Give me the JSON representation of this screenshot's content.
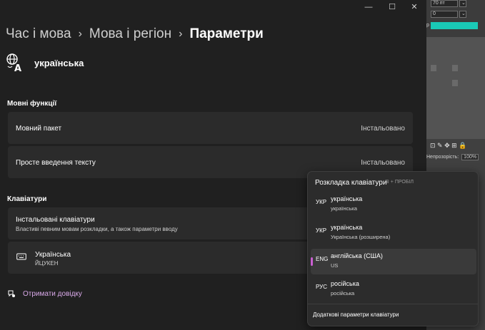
{
  "breadcrumb": {
    "item1": "Час і мова",
    "item2": "Мова і регіон",
    "current": "Параметри"
  },
  "language": {
    "title": "українська",
    "icon": "language-icon"
  },
  "lang_features": {
    "title": "Мовні функції",
    "items": [
      {
        "label": "Мовний пакет",
        "status": "Інстальовано"
      },
      {
        "label": "Просте введення тексту",
        "status": "Інстальовано"
      }
    ]
  },
  "keyboards": {
    "title": "Клавіатури",
    "installed": {
      "label": "Інстальовані клавіатури",
      "sub": "Властиві певним мовам розкладки, а також параметри вводу"
    },
    "keyboard": {
      "name": "Українська",
      "layout": "ЙЦУКЕН",
      "icon": "keyboard-icon"
    }
  },
  "help": {
    "label": "Отримати довідку",
    "icon": "help-icon"
  },
  "window_controls": {
    "minimize": "—",
    "maximize": "☐",
    "close": "✕"
  },
  "flyout": {
    "title": "Розкладка клавіатури",
    "hint": "⊞ + ПРОБІЛ",
    "items": [
      {
        "code": "УКР",
        "name": "українська",
        "sub": "українська"
      },
      {
        "code": "УКР",
        "name": "українська",
        "sub": "Українська (розширена)"
      },
      {
        "code": "ENG",
        "name": "англійська (США)",
        "sub": "US",
        "selected": true
      },
      {
        "code": "РУС",
        "name": "російська",
        "sub": "російська"
      }
    ],
    "footer": "Додаткові параметри клавіатури",
    "accent_color": "#c95fd1"
  },
  "background_app": {
    "font_size": "70 пт",
    "value_field": "0",
    "opacity_label": "Непрозорість:",
    "opacity_value": "100%",
    "swatch_color": "#1ac9b6",
    "field_partial": "р"
  }
}
